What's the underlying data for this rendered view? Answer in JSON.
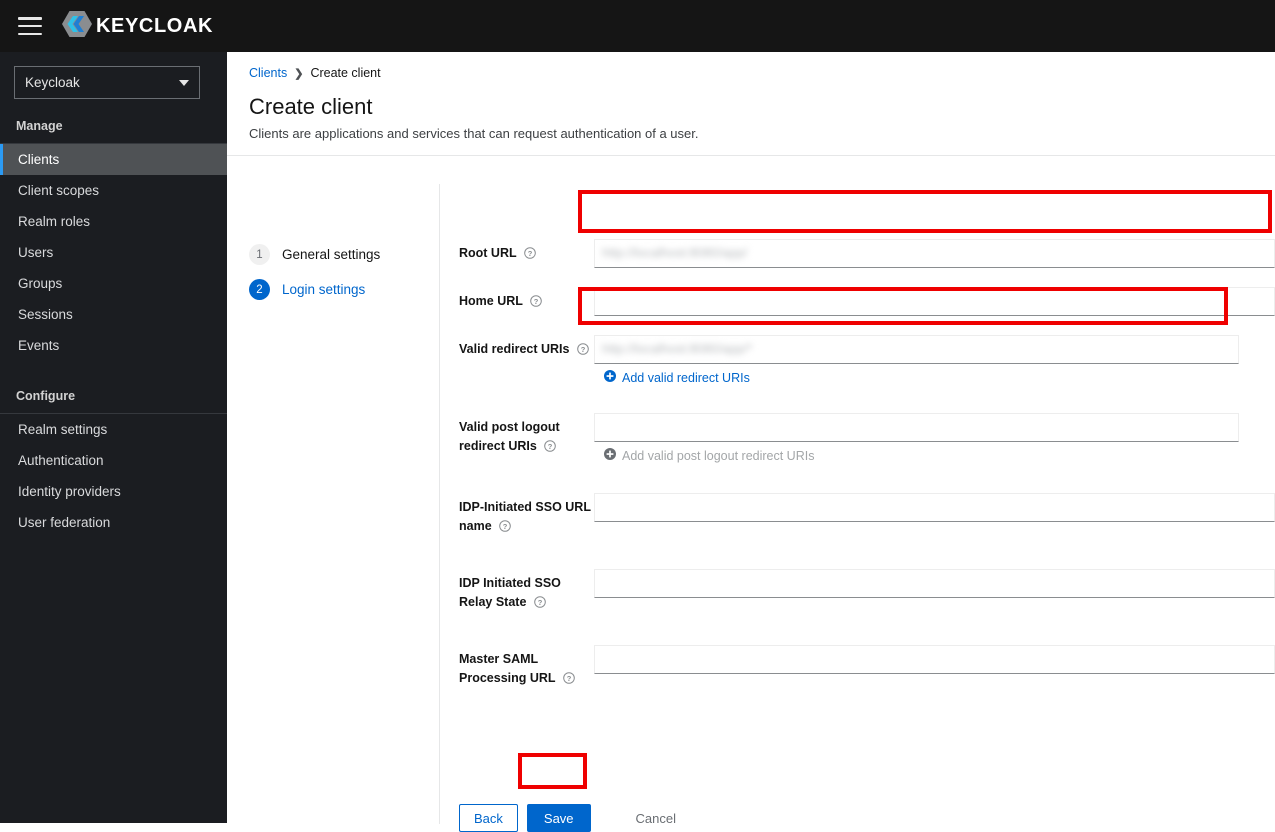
{
  "masthead": {
    "menu_icon": "hamburger-icon",
    "brand_name": "KEYCLOAK",
    "brand_logo_icon": "keycloak-hexagon-logo"
  },
  "sidebar": {
    "realm_selector": {
      "value": "Keycloak",
      "caret_icon": "chevron-down-icon"
    },
    "groups": [
      {
        "title": "Manage",
        "items": [
          {
            "label": "Clients",
            "active": true
          },
          {
            "label": "Client scopes",
            "active": false
          },
          {
            "label": "Realm roles",
            "active": false
          },
          {
            "label": "Users",
            "active": false
          },
          {
            "label": "Groups",
            "active": false
          },
          {
            "label": "Sessions",
            "active": false
          },
          {
            "label": "Events",
            "active": false
          }
        ]
      },
      {
        "title": "Configure",
        "items": [
          {
            "label": "Realm settings",
            "active": false
          },
          {
            "label": "Authentication",
            "active": false
          },
          {
            "label": "Identity providers",
            "active": false
          },
          {
            "label": "User federation",
            "active": false
          }
        ]
      }
    ]
  },
  "page": {
    "breadcrumb": {
      "parent": "Clients",
      "separator": "❯",
      "current": "Create client"
    },
    "title": "Create client",
    "subtitle": "Clients are applications and services that can request authentication of a user."
  },
  "wizard": {
    "steps": [
      {
        "number": "1",
        "label": "General settings",
        "active": false
      },
      {
        "number": "2",
        "label": "Login settings",
        "active": true
      }
    ]
  },
  "form": {
    "help_icon": "help-circle-icon",
    "remove_icon": "minus-circle-icon",
    "add_icon": "plus-circle-icon",
    "fields": [
      {
        "label": "Root URL",
        "value": "http://localhost:8080/app/",
        "redacted": true,
        "placeholder": "",
        "highlighted": true,
        "has_remove": false,
        "add_link": null
      },
      {
        "label": "Home URL",
        "value": "",
        "redacted": false,
        "placeholder": "",
        "highlighted": false,
        "has_remove": false,
        "add_link": null
      },
      {
        "label": "Valid redirect URIs",
        "value": "http://localhost:8080/app/*",
        "redacted": true,
        "placeholder": "",
        "highlighted": true,
        "has_remove": true,
        "add_link": {
          "label": "Add valid redirect URIs",
          "disabled": false
        }
      },
      {
        "label": "Valid post logout redirect URIs",
        "value": "",
        "redacted": false,
        "placeholder": "",
        "highlighted": false,
        "has_remove": true,
        "add_link": {
          "label": "Add valid post logout redirect URIs",
          "disabled": true
        }
      },
      {
        "label": "IDP-Initiated SSO URL name",
        "value": "",
        "redacted": false,
        "placeholder": "",
        "highlighted": false,
        "has_remove": false,
        "add_link": null
      },
      {
        "label": "IDP Initiated SSO Relay State",
        "value": "",
        "redacted": false,
        "placeholder": "",
        "highlighted": false,
        "has_remove": false,
        "add_link": null
      },
      {
        "label": "Master SAML Processing URL",
        "value": "",
        "redacted": false,
        "placeholder": "",
        "highlighted": false,
        "has_remove": false,
        "add_link": null
      }
    ]
  },
  "footer": {
    "back_label": "Back",
    "save_label": "Save",
    "cancel_label": "Cancel",
    "save_highlighted": true
  },
  "colors": {
    "accent_blue": "#0066cc",
    "link_blue": "#06c",
    "annotation_red": "#ef0000",
    "masthead_bg": "#151515",
    "sidebar_bg": "#1b1d21",
    "sidebar_active_bg": "#4f5255"
  }
}
